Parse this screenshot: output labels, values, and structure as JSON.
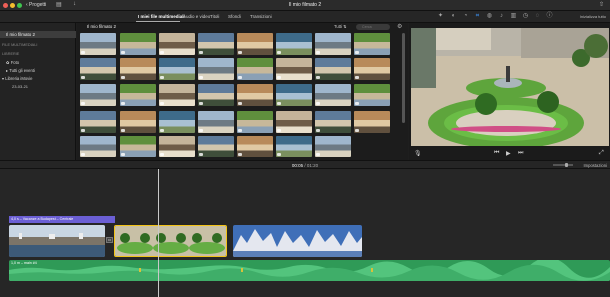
{
  "window": {
    "back_label": "‹ Progetti",
    "title": "Il mio filmato 2"
  },
  "tabs": {
    "media": "I miei file multimediali",
    "audio_video": "Audio e video",
    "titles": "Titoli",
    "backgrounds": "Sfondi",
    "transitions": "Transizioni"
  },
  "viewer_tools": {
    "reset_all": "Inizializza tutto"
  },
  "sidebar": {
    "project": "Il mio filmato 2",
    "section_media": "FILE MULTIMEDIALI",
    "section_libraries": "LIBRERIE",
    "items": [
      {
        "label": "Foto"
      },
      {
        "label": "Tutti gli eventi"
      },
      {
        "label": "Libreria iMovie"
      }
    ],
    "date": "23-03-21"
  },
  "browser": {
    "title": "Il mio filmato 2",
    "filter": "Tutti ⇅",
    "search_placeholder": "Cerca"
  },
  "timebar": {
    "current": "00:05",
    "separator": " / ",
    "total": "01:20",
    "settings": "Impostazioni"
  },
  "timeline": {
    "audio_clip_label": "4,0 s – Vacanze a Budapest – Centrale",
    "music_label": "1,0 m – main #4"
  },
  "colors": {
    "accent": "#3b8ff0",
    "selection": "#f2c318",
    "music": "#2f9a57",
    "title_clip": "#6b5fd4"
  },
  "icons": [
    "back-icon",
    "library-icon",
    "export-icon",
    "gear-icon",
    "search-icon",
    "mic-icon",
    "prev-icon",
    "play-icon",
    "next-icon",
    "fullscreen-icon"
  ]
}
